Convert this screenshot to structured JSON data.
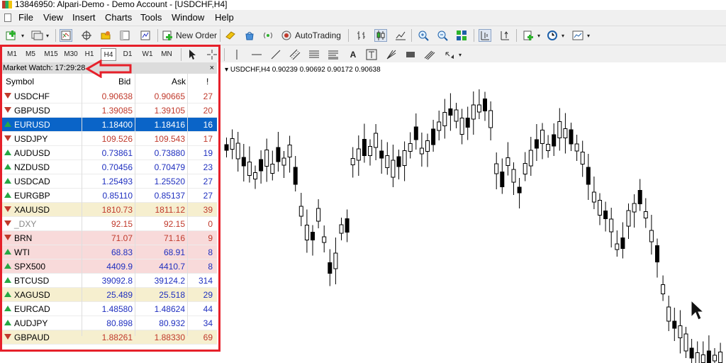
{
  "window": {
    "title": "13846950: Alpari-Demo - Demo Account - [USDCHF,H4]"
  },
  "menu": [
    "File",
    "View",
    "Insert",
    "Charts",
    "Tools",
    "Window",
    "Help"
  ],
  "toolbar": {
    "new_order_label": "New Order",
    "autotrading_label": "AutoTrading"
  },
  "timeframes": [
    "M1",
    "M5",
    "M15",
    "M30",
    "H1",
    "H4",
    "D1",
    "W1",
    "MN"
  ],
  "active_timeframe": "H4",
  "market_watch": {
    "title": "Market Watch: 17:29:28",
    "close_glyph": "×",
    "columns": {
      "symbol": "Symbol",
      "bid": "Bid",
      "ask": "Ask",
      "spread": "!"
    },
    "rows": [
      {
        "symbol": "USDCHF",
        "bid": "0.90638",
        "ask": "0.90665",
        "spread": "27",
        "dir": "down",
        "color": "red",
        "bg": "#ffffff"
      },
      {
        "symbol": "GBPUSD",
        "bid": "1.39085",
        "ask": "1.39105",
        "spread": "20",
        "dir": "down",
        "color": "red",
        "bg": "#ffffff"
      },
      {
        "symbol": "EURUSD",
        "bid": "1.18400",
        "ask": "1.18416",
        "spread": "16",
        "dir": "up",
        "color": "blue",
        "bg": "#0a64c8",
        "selected": true
      },
      {
        "symbol": "USDJPY",
        "bid": "109.526",
        "ask": "109.543",
        "spread": "17",
        "dir": "down",
        "color": "red",
        "bg": "#ffffff"
      },
      {
        "symbol": "AUDUSD",
        "bid": "0.73861",
        "ask": "0.73880",
        "spread": "19",
        "dir": "up",
        "color": "blue",
        "bg": "#ffffff"
      },
      {
        "symbol": "NZDUSD",
        "bid": "0.70456",
        "ask": "0.70479",
        "spread": "23",
        "dir": "up",
        "color": "blue",
        "bg": "#ffffff"
      },
      {
        "symbol": "USDCAD",
        "bid": "1.25493",
        "ask": "1.25520",
        "spread": "27",
        "dir": "up",
        "color": "blue",
        "bg": "#ffffff"
      },
      {
        "symbol": "EURGBP",
        "bid": "0.85110",
        "ask": "0.85137",
        "spread": "27",
        "dir": "up",
        "color": "blue",
        "bg": "#ffffff"
      },
      {
        "symbol": "XAUUSD",
        "bid": "1810.73",
        "ask": "1811.12",
        "spread": "39",
        "dir": "down",
        "color": "red",
        "bg": "#f6efcf"
      },
      {
        "symbol": "_DXY",
        "bid": "92.15",
        "ask": "92.15",
        "spread": "0",
        "dir": "down",
        "color": "red",
        "bg": "#ffffff",
        "muted": true
      },
      {
        "symbol": "BRN",
        "bid": "71.07",
        "ask": "71.16",
        "spread": "9",
        "dir": "down",
        "color": "red",
        "bg": "#f8dada"
      },
      {
        "symbol": "WTI",
        "bid": "68.83",
        "ask": "68.91",
        "spread": "8",
        "dir": "up",
        "color": "blue",
        "bg": "#f8dada"
      },
      {
        "symbol": "SPX500",
        "bid": "4409.9",
        "ask": "4410.7",
        "spread": "8",
        "dir": "up",
        "color": "blue",
        "bg": "#f8dada"
      },
      {
        "symbol": "BTCUSD",
        "bid": "39092.8",
        "ask": "39124.2",
        "spread": "314",
        "dir": "up",
        "color": "blue",
        "bg": "#ffffff"
      },
      {
        "symbol": "XAGUSD",
        "bid": "25.489",
        "ask": "25.518",
        "spread": "29",
        "dir": "up",
        "color": "blue",
        "bg": "#f6efcf"
      },
      {
        "symbol": "EURCAD",
        "bid": "1.48580",
        "ask": "1.48624",
        "spread": "44",
        "dir": "up",
        "color": "blue",
        "bg": "#ffffff"
      },
      {
        "symbol": "AUDJPY",
        "bid": "80.898",
        "ask": "80.932",
        "spread": "34",
        "dir": "up",
        "color": "blue",
        "bg": "#ffffff"
      },
      {
        "symbol": "GBPAUD",
        "bid": "1.88261",
        "ask": "1.88330",
        "spread": "69",
        "dir": "down",
        "color": "red",
        "bg": "#f6efcf"
      }
    ]
  },
  "chart": {
    "header": "USDCHF,H4  0.90239 0.90692 0.90172 0.90638"
  },
  "colors": {
    "highlight_box": "#e6202a",
    "selection": "#0a64c8",
    "bid_up": "#1f2fbf",
    "bid_down": "#c0392b"
  }
}
